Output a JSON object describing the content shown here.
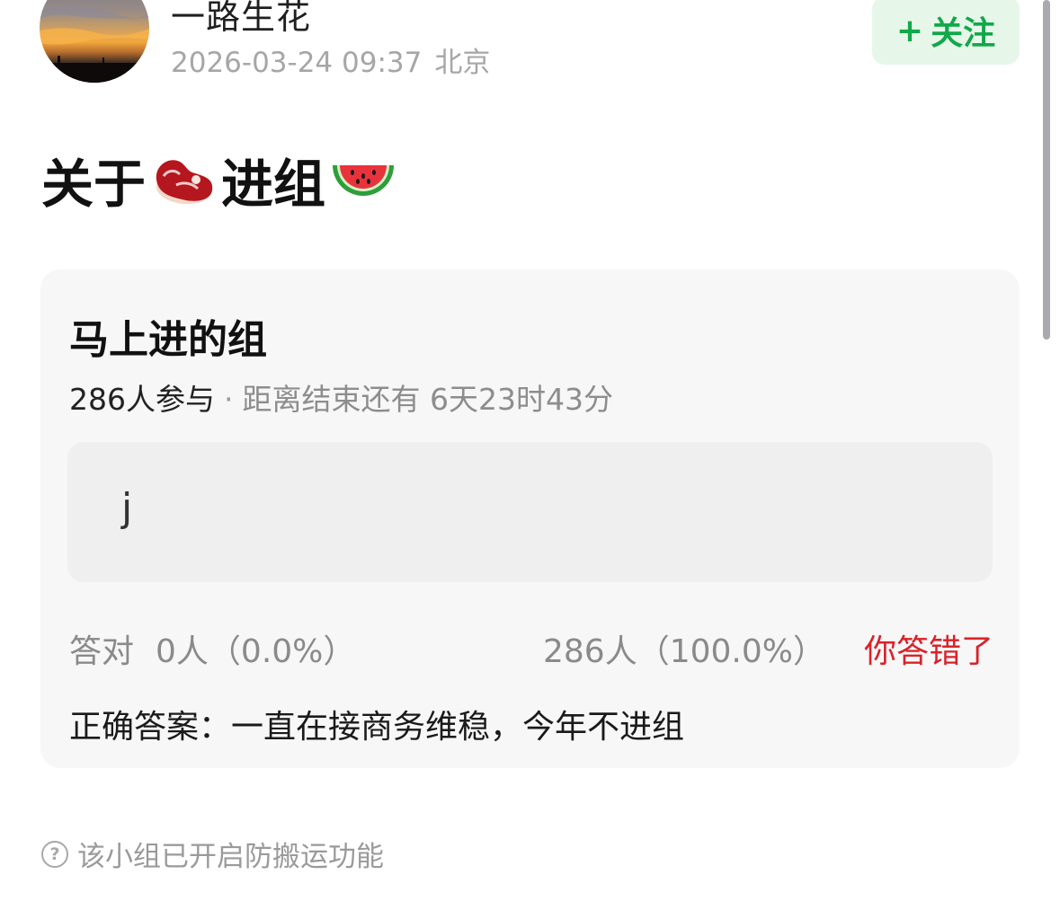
{
  "header": {
    "author_name": "一路生花",
    "post_time": "2026-03-24 09:37",
    "location": "北京",
    "follow_plus": "+",
    "follow_label": "关注"
  },
  "post": {
    "title_part1": "关于",
    "title_emoji1": "meat-icon",
    "title_part2": "进组",
    "title_emoji2": "watermelon-icon"
  },
  "poll": {
    "title": "马上进的组",
    "participants": "286人参与",
    "separator": "·",
    "countdown": "距离结束还有 6天23时43分",
    "answer": "j",
    "correct_label": "答对",
    "correct_stat": "0人（0.0%）",
    "wrong_stat": "286人（100.0%）",
    "result": "你答错了",
    "correct_answer": "正确答案：一直在接商务维稳，今年不进组"
  },
  "footer": {
    "note": "该小组已开启防搬运功能",
    "help_glyph": "?"
  },
  "colors": {
    "follow_bg": "#e6f7ea",
    "follow_text": "#12a84a",
    "wrong_result": "#d9222a",
    "card_bg": "#f7f7f7"
  }
}
